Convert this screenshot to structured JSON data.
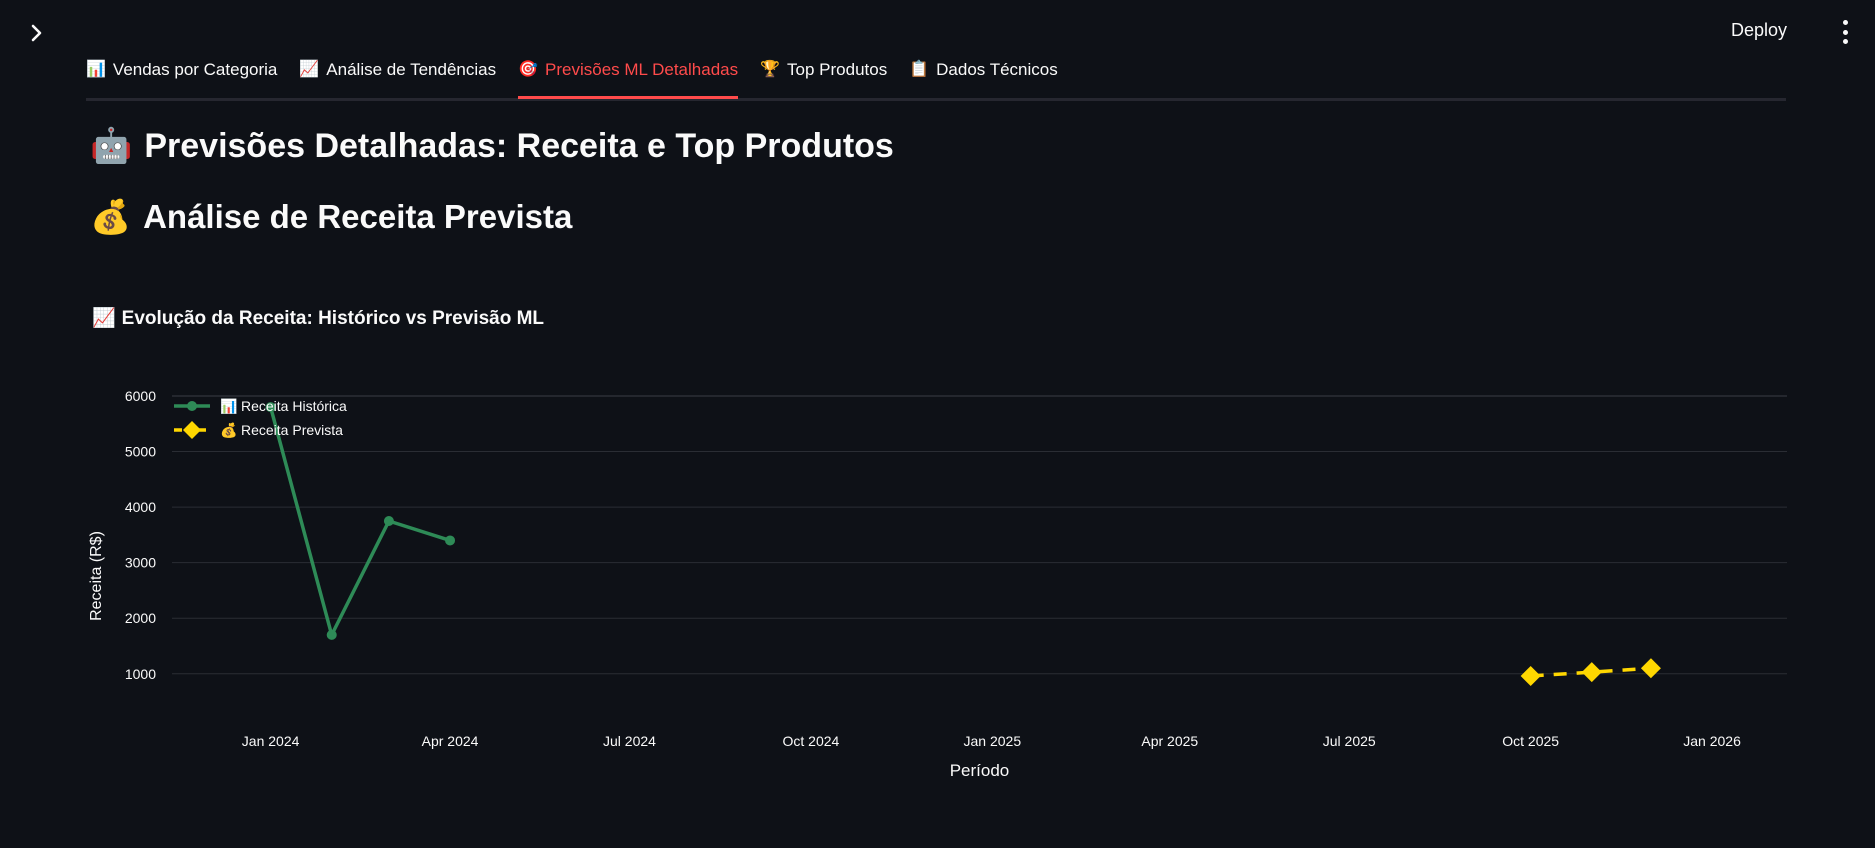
{
  "header": {
    "deploy_label": "Deploy"
  },
  "tabs": [
    {
      "icon": "📊",
      "label": "Vendas por Categoria",
      "active": false
    },
    {
      "icon": "📈",
      "label": "Análise de Tendências",
      "active": false
    },
    {
      "icon": "🎯",
      "label": "Previsões ML Detalhadas",
      "active": true
    },
    {
      "icon": "🏆",
      "label": "Top Produtos",
      "active": false
    },
    {
      "icon": "📋",
      "label": "Dados Técnicos",
      "active": false
    }
  ],
  "main": {
    "title_icon": "🤖",
    "title": "Previsões Detalhadas: Receita e Top Produtos",
    "subtitle_icon": "💰",
    "subtitle": "Análise de Receita Prevista",
    "chart_heading_icon": "📈",
    "chart_heading": "Evolução da Receita: Histórico vs Previsão ML"
  },
  "colors": {
    "accent": "#ff4b4b",
    "historic": "#2e8b57",
    "forecast": "#ffd700",
    "background": "#0e1117"
  },
  "chart_data": {
    "type": "line",
    "xlabel": "Período",
    "ylabel": "Receita (R$)",
    "x_ticks": [
      "Jan 2024",
      "Apr 2024",
      "Jul 2024",
      "Oct 2024",
      "Jan 2025",
      "Apr 2025",
      "Jul 2025",
      "Oct 2025",
      "Jan 2026"
    ],
    "y_ticks": [
      1000,
      2000,
      3000,
      4000,
      5000,
      6000
    ],
    "xlim": [
      "2023-11-12",
      "2026-02-08"
    ],
    "ylim": [
      600,
      6000
    ],
    "grid": true,
    "legend_position": "top-left",
    "series": [
      {
        "name": "Receita Histórica",
        "legend_icon": "📊",
        "color": "#2e8b57",
        "marker": "circle",
        "dash": "solid",
        "points": [
          {
            "x": "2024-01-01",
            "y": 5800
          },
          {
            "x": "2024-02-01",
            "y": 1700
          },
          {
            "x": "2024-03-01",
            "y": 3750
          },
          {
            "x": "2024-04-01",
            "y": 3400
          }
        ]
      },
      {
        "name": "Receita Prevista",
        "legend_icon": "💰",
        "color": "#ffd700",
        "marker": "diamond",
        "dash": "dashed",
        "points": [
          {
            "x": "2025-10-01",
            "y": 960
          },
          {
            "x": "2025-11-01",
            "y": 1030
          },
          {
            "x": "2025-12-01",
            "y": 1100
          }
        ]
      }
    ]
  }
}
